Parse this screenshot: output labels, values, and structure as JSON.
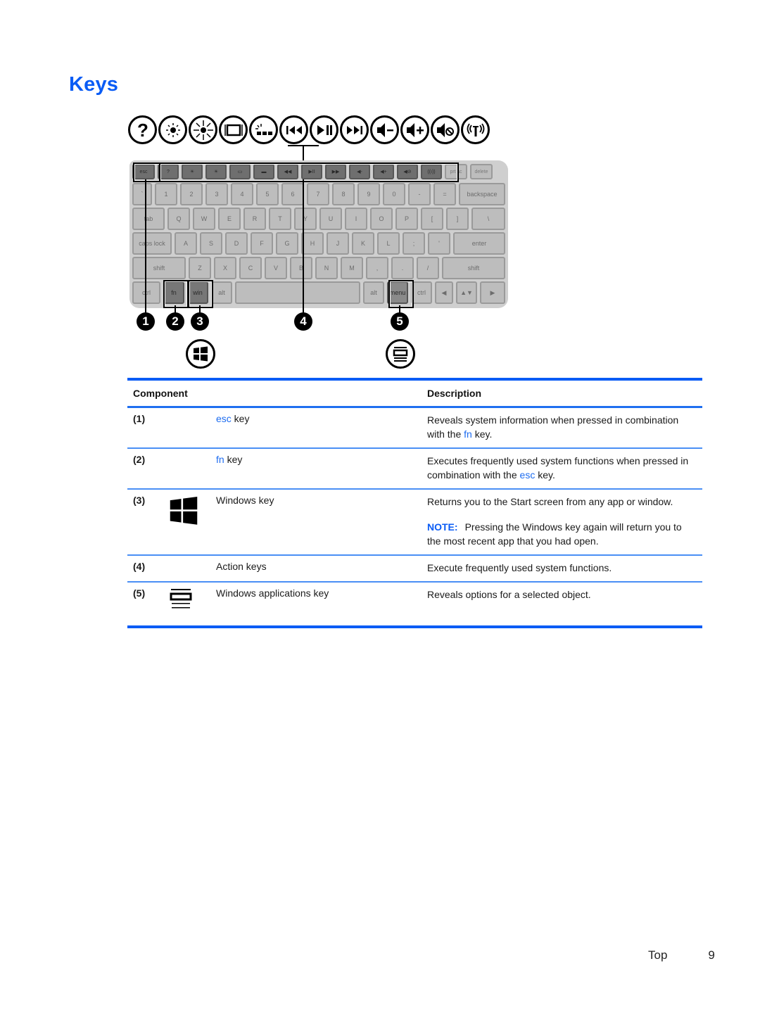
{
  "page": {
    "title": "Keys"
  },
  "illustration": {
    "action_key_icons": [
      "help-question-icon",
      "brightness-down-icon",
      "brightness-up-icon",
      "display-switch-icon",
      "keyboard-backlight-icon",
      "previous-track-icon",
      "play-pause-icon",
      "next-track-icon",
      "volume-down-icon",
      "volume-up-icon",
      "mute-icon",
      "wireless-icon"
    ],
    "callouts": [
      "1",
      "2",
      "3",
      "4",
      "5"
    ],
    "keyboard": {
      "fn_row": [
        "esc",
        "?",
        "☀",
        "☀",
        "▭",
        "▬",
        "◀◀",
        "▶II",
        "▶▶",
        "◀-",
        "◀+",
        "◀⊘",
        "((ı))",
        "prt sc",
        "delete"
      ],
      "row1": [
        "`",
        "1",
        "2",
        "3",
        "4",
        "5",
        "6",
        "7",
        "8",
        "9",
        "0",
        "-",
        "=",
        "backspace"
      ],
      "row2": [
        "tab",
        "Q",
        "W",
        "E",
        "R",
        "T",
        "Y",
        "U",
        "I",
        "O",
        "P",
        "[",
        "]",
        "\\"
      ],
      "row3": [
        "caps lock",
        "A",
        "S",
        "D",
        "F",
        "G",
        "H",
        "J",
        "K",
        "L",
        ";",
        "'",
        "enter"
      ],
      "row4": [
        "shift",
        "Z",
        "X",
        "C",
        "V",
        "B",
        "N",
        "M",
        ",",
        ".",
        "/",
        "shift"
      ],
      "row5": [
        "ctrl",
        "fn",
        "win",
        "alt",
        "",
        "alt",
        "menu",
        "ctrl",
        "◀",
        "▲▼",
        "▶"
      ]
    }
  },
  "table": {
    "headers": {
      "component": "Component",
      "description": "Description"
    },
    "rows": [
      {
        "num": "(1)",
        "icon": "",
        "name_prefix": "esc",
        "name_suffix": " key",
        "desc_parts": [
          "Reveals system information when pressed in combination with the ",
          "fn",
          " key."
        ],
        "note_label": "",
        "note_text": ""
      },
      {
        "num": "(2)",
        "icon": "",
        "name_prefix": "fn",
        "name_suffix": " key",
        "desc_parts": [
          "Executes frequently used system functions when pressed in combination with the ",
          "esc",
          " key."
        ],
        "note_label": "",
        "note_text": ""
      },
      {
        "num": "(3)",
        "icon": "windows-logo-icon",
        "name_prefix": "",
        "name_suffix": "Windows key",
        "desc_parts": [
          "Returns you to the Start screen from any app or window.",
          "",
          ""
        ],
        "note_label": "NOTE:",
        "note_text": "Pressing the Windows key again will return you to the most recent app that you had open."
      },
      {
        "num": "(4)",
        "icon": "",
        "name_prefix": "",
        "name_suffix": "Action keys",
        "desc_parts": [
          "Execute frequently used system functions.",
          "",
          ""
        ],
        "note_label": "",
        "note_text": ""
      },
      {
        "num": "(5)",
        "icon": "windows-applications-icon",
        "name_prefix": "",
        "name_suffix": "Windows applications key",
        "desc_parts": [
          "Reveals options for a selected object.",
          "",
          ""
        ],
        "note_label": "",
        "note_text": ""
      }
    ]
  },
  "footer": {
    "section": "Top",
    "page_number": "9"
  },
  "colors": {
    "accent": "#0a5cf5",
    "link": "#1d6cf0"
  }
}
